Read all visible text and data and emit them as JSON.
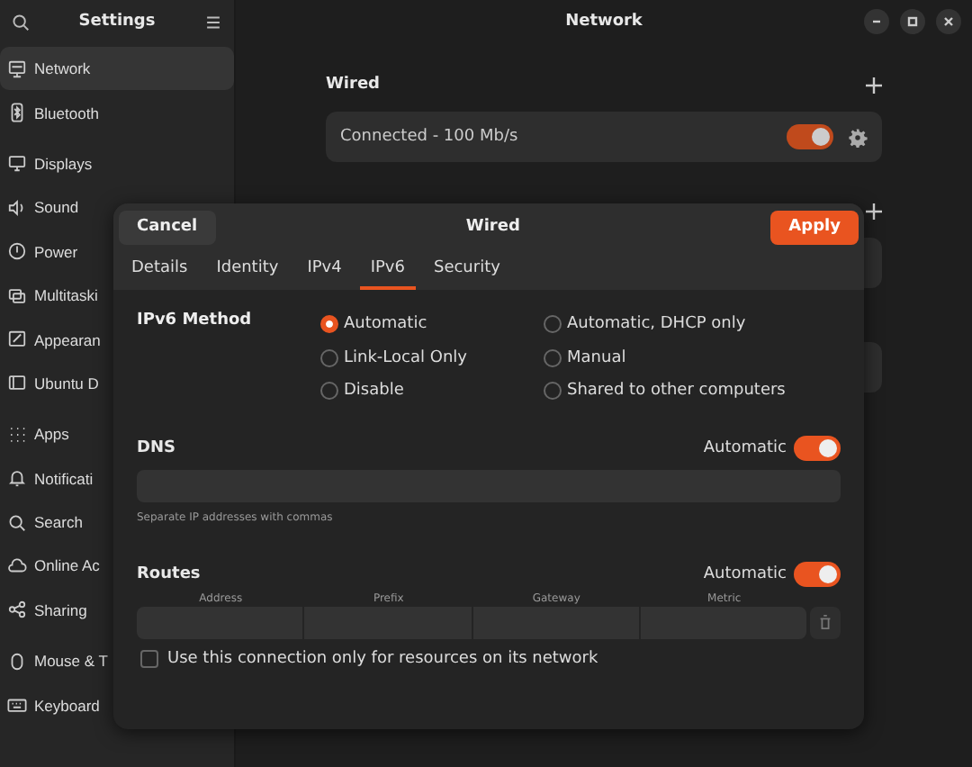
{
  "sidebar": {
    "title": "Settings",
    "items": [
      {
        "label": "Network",
        "selected": true
      },
      {
        "label": "Bluetooth",
        "selected": false
      },
      {
        "label": "Displays",
        "selected": false
      },
      {
        "label": "Sound",
        "selected": false
      },
      {
        "label": "Power",
        "selected": false
      },
      {
        "label": "Multitaski",
        "selected": false
      },
      {
        "label": "Appearan",
        "selected": false
      },
      {
        "label": "Ubuntu D",
        "selected": false
      },
      {
        "label": "Apps",
        "selected": false
      },
      {
        "label": "Notificati",
        "selected": false
      },
      {
        "label": "Search",
        "selected": false
      },
      {
        "label": "Online Ac",
        "selected": false
      },
      {
        "label": "Sharing",
        "selected": false
      },
      {
        "label": "Mouse & T",
        "selected": false
      },
      {
        "label": "Keyboard",
        "selected": false
      }
    ]
  },
  "window": {
    "title": "Network"
  },
  "wired": {
    "heading": "Wired",
    "status": "Connected - 100 Mb/s",
    "on": true
  },
  "dialog": {
    "title": "Wired",
    "cancel": "Cancel",
    "apply": "Apply",
    "tabs": [
      {
        "label": "Details",
        "selected": false
      },
      {
        "label": "Identity",
        "selected": false
      },
      {
        "label": "IPv4",
        "selected": false
      },
      {
        "label": "IPv6",
        "selected": true
      },
      {
        "label": "Security",
        "selected": false
      }
    ],
    "method_label": "IPv6 Method",
    "methods": [
      {
        "label": "Automatic",
        "selected": true
      },
      {
        "label": "Link-Local Only",
        "selected": false
      },
      {
        "label": "Disable",
        "selected": false
      },
      {
        "label": "Automatic, DHCP only",
        "selected": false
      },
      {
        "label": "Manual",
        "selected": false
      },
      {
        "label": "Shared to other computers",
        "selected": false
      }
    ],
    "dns": {
      "heading": "DNS",
      "auto_label": "Automatic",
      "auto": true,
      "hint": "Separate IP addresses with commas"
    },
    "routes": {
      "heading": "Routes",
      "auto_label": "Automatic",
      "auto": true,
      "columns": [
        "Address",
        "Prefix",
        "Gateway",
        "Metric"
      ]
    },
    "only_local": {
      "label": "Use this connection only for resources on its network",
      "checked": false
    }
  }
}
